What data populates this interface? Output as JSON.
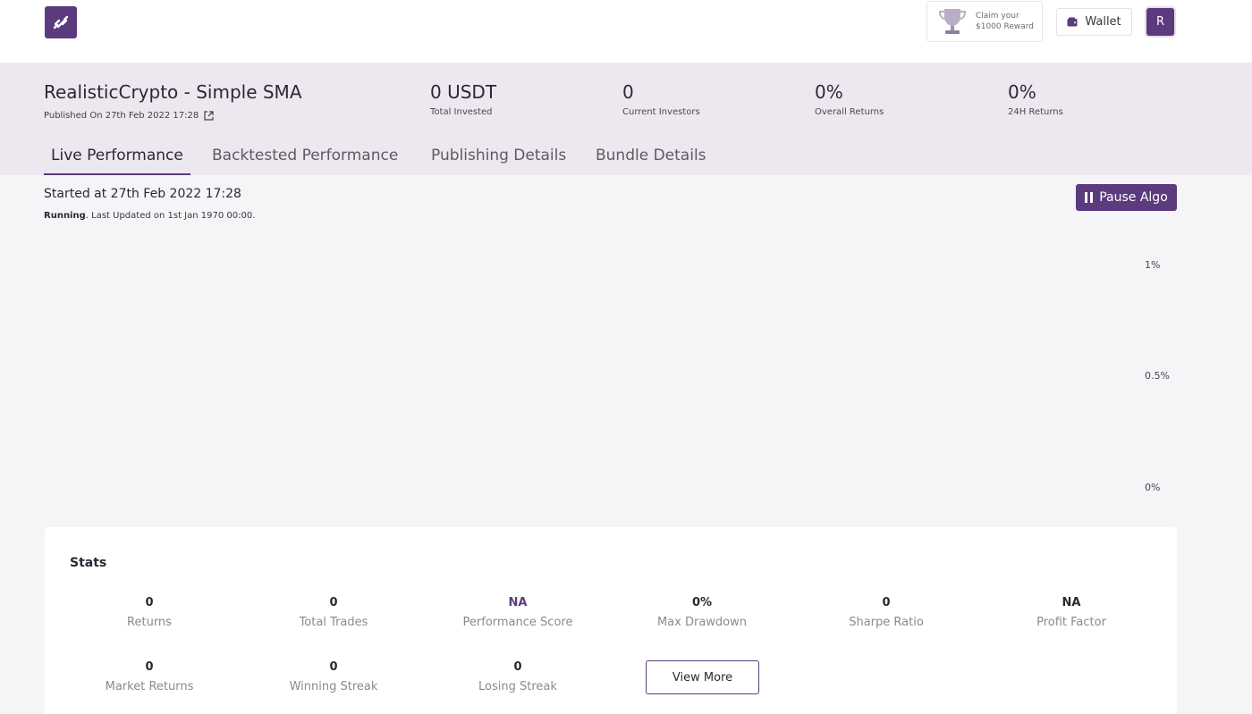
{
  "topbar": {
    "logo_icon": "chain-link-icon",
    "reward_line1": "Claim your",
    "reward_line2": "$1000 Reward",
    "wallet_label": "Wallet",
    "avatar_initial": "R"
  },
  "algo": {
    "title": "RealisticCrypto - Simple SMA",
    "published": "Published On 27th Feb 2022 17:28"
  },
  "metrics": [
    {
      "value": "0 USDT",
      "label": "Total Invested"
    },
    {
      "value": "0",
      "label": "Current Investors"
    },
    {
      "value": "0%",
      "label": "Overall Returns"
    },
    {
      "value": "0%",
      "label": "24H Returns"
    }
  ],
  "tabs": [
    {
      "label": "Live Performance",
      "active": true
    },
    {
      "label": "Backtested Performance",
      "active": false
    },
    {
      "label": "Publishing Details",
      "active": false
    },
    {
      "label": "Bundle Details",
      "active": false
    }
  ],
  "status": {
    "started": "Started at 27th Feb 2022 17:28",
    "running_bold": "Running",
    "running_rest": ". Last Updated on 1st Jan 1970 00:00."
  },
  "pause_label": "Pause Algo",
  "chart_data": {
    "type": "line",
    "series": [],
    "y_ticks": [
      "1%",
      "0.5%",
      "0%"
    ],
    "ylim": [
      0,
      1
    ]
  },
  "stats": {
    "title": "Stats",
    "items": [
      {
        "value": "0",
        "label": "Returns"
      },
      {
        "value": "0",
        "label": "Total Trades"
      },
      {
        "value": "NA",
        "label": "Performance Score"
      },
      {
        "value": "0%",
        "label": "Max Drawdown"
      },
      {
        "value": "0",
        "label": "Sharpe Ratio"
      },
      {
        "value": "NA",
        "label": "Profit Factor"
      },
      {
        "value": "0",
        "label": "Market Returns"
      },
      {
        "value": "0",
        "label": "Winning Streak"
      },
      {
        "value": "0",
        "label": "Losing Streak"
      }
    ],
    "view_more_label": "View More"
  },
  "colors": {
    "brand": "#5b3a7e",
    "header_band": "#ede8f0",
    "page_bg": "#f5f4f6"
  }
}
